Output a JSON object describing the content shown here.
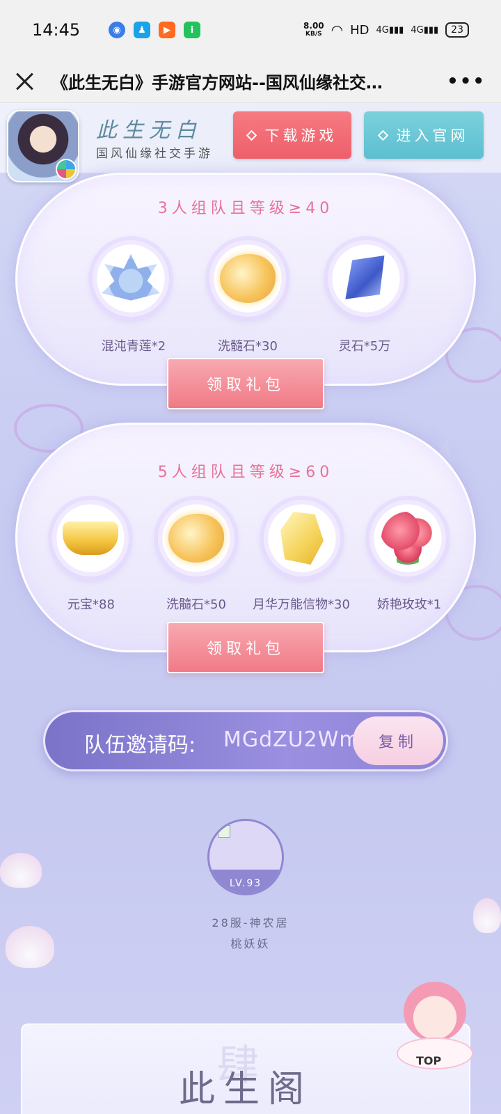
{
  "status_bar": {
    "time": "14:45",
    "net_speed_value": "8.00",
    "net_speed_unit": "KB/S",
    "hd": "HD",
    "signal1": "4G",
    "signal2": "4G",
    "battery": "23",
    "app_icons": [
      "browser-icon",
      "qq-icon",
      "kuaishou-icon",
      "iqiyi-icon"
    ]
  },
  "browser": {
    "title": "《此生无白》手游官方网站--国风仙缘社交…",
    "more": "•••"
  },
  "game_header": {
    "name": "此生无白",
    "subtitle": "国风仙缘社交手游",
    "download_label": "下载游戏",
    "official_label": "进入官网"
  },
  "rewards": [
    {
      "title": "3人组队且等级≥40",
      "items": [
        {
          "label": "混沌青莲*2",
          "icon": "lotus-icon"
        },
        {
          "label": "洗髓石*30",
          "icon": "stone-icon"
        },
        {
          "label": "灵石*5万",
          "icon": "crystal-icon"
        }
      ],
      "claim_label": "领取礼包"
    },
    {
      "title": "5人组队且等级≥60",
      "items": [
        {
          "label": "元宝*88",
          "icon": "ingot-icon"
        },
        {
          "label": "洗髓石*50",
          "icon": "stone-icon"
        },
        {
          "label": "月华万能信物*30",
          "icon": "gem-icon"
        },
        {
          "label": "娇艳玫玫*1",
          "icon": "rose-icon"
        }
      ],
      "claim_label": "领取礼包"
    }
  ],
  "invite": {
    "label": "队伍邀请码:",
    "code": "MGdZU2Wm",
    "copy_label": "复制"
  },
  "member": {
    "level": "LV.93",
    "server": "28服-神农居",
    "name": "桃妖妖"
  },
  "bottom": {
    "title": "此生阁",
    "watermark": "肆"
  },
  "top_button": "TOP",
  "colors": {
    "accent_pink": "#f07a86",
    "accent_teal": "#5cbfd0",
    "title_pink": "#e6739a",
    "invite_purple": "#7a73c8"
  }
}
